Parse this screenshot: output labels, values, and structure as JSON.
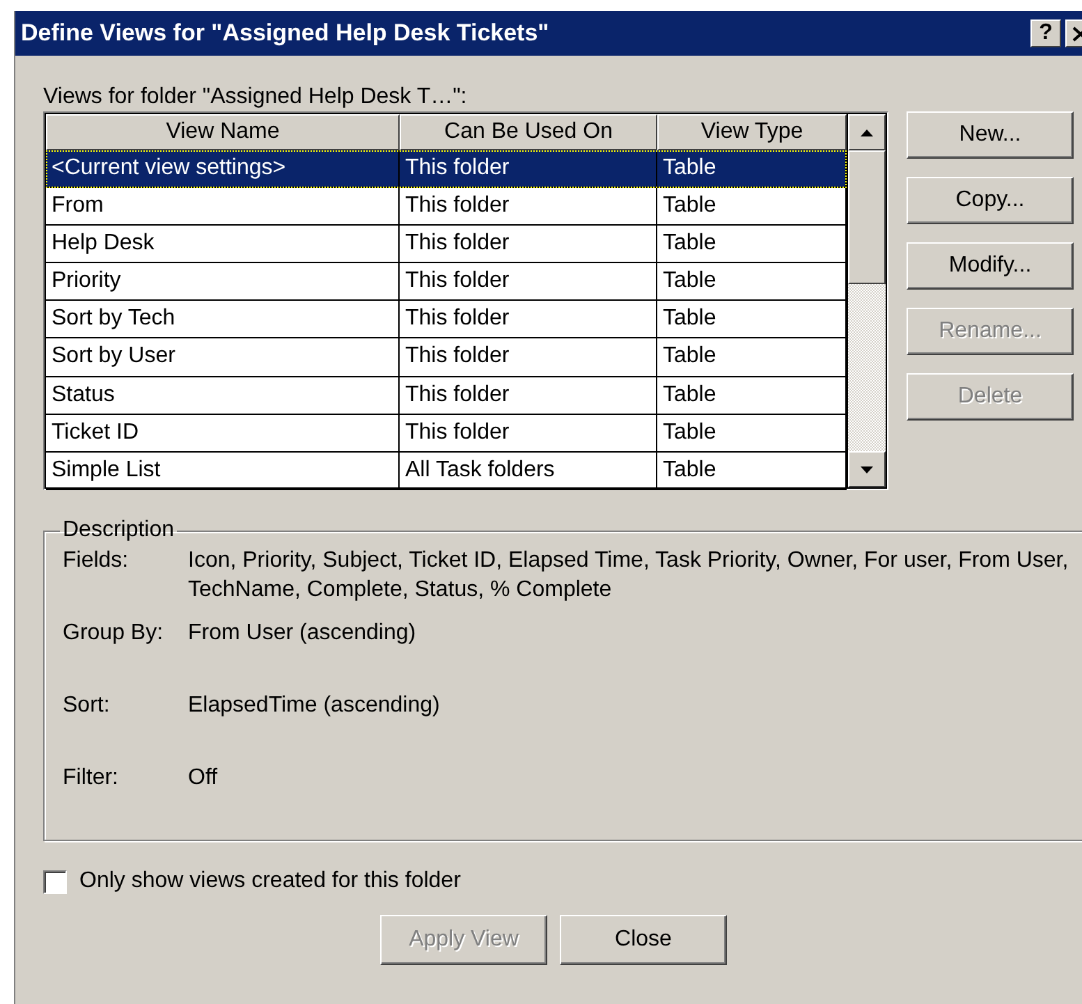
{
  "window": {
    "title": "Define Views for \"Assigned Help Desk Tickets\"",
    "help_button": "?"
  },
  "views_label": "Views for folder \"Assigned Help Desk T…\":",
  "table": {
    "columns": [
      "View Name",
      "Can Be Used On",
      "View Type"
    ],
    "rows": [
      {
        "cells": [
          "<Current view settings>",
          "This folder",
          "Table"
        ],
        "selected": true
      },
      {
        "cells": [
          "From",
          "This folder",
          "Table"
        ],
        "selected": false
      },
      {
        "cells": [
          "Help Desk",
          "This folder",
          "Table"
        ],
        "selected": false
      },
      {
        "cells": [
          "Priority",
          "This folder",
          "Table"
        ],
        "selected": false
      },
      {
        "cells": [
          "Sort by Tech",
          "This folder",
          "Table"
        ],
        "selected": false
      },
      {
        "cells": [
          "Sort by User",
          "This folder",
          "Table"
        ],
        "selected": false
      },
      {
        "cells": [
          "Status",
          "This folder",
          "Table"
        ],
        "selected": false
      },
      {
        "cells": [
          "Ticket ID",
          "This folder",
          "Table"
        ],
        "selected": false
      },
      {
        "cells": [
          "Simple List",
          "All Task folders",
          "Table"
        ],
        "selected": false
      }
    ]
  },
  "side_buttons": [
    {
      "label": "New...",
      "disabled": false
    },
    {
      "label": "Copy...",
      "disabled": false
    },
    {
      "label": "Modify...",
      "disabled": false
    },
    {
      "label": "Rename...",
      "disabled": true
    },
    {
      "label": "Delete",
      "disabled": true
    }
  ],
  "description": {
    "title": "Description",
    "items": [
      {
        "label": "Fields:",
        "value": "Icon, Priority, Subject, Ticket ID, Elapsed Time, Task Priority, Owner, For user, From User, TechName, Complete, Status, % Complete"
      },
      {
        "label": "Group By:",
        "value": "From User (ascending)"
      },
      {
        "label": "Sort:",
        "value": "ElapsedTime (ascending)"
      },
      {
        "label": "Filter:",
        "value": "Off"
      }
    ]
  },
  "checkbox": {
    "label": "Only show views created for this folder",
    "checked": false
  },
  "footer_buttons": [
    {
      "label": "Apply View",
      "disabled": true
    },
    {
      "label": "Close",
      "disabled": false
    }
  ]
}
